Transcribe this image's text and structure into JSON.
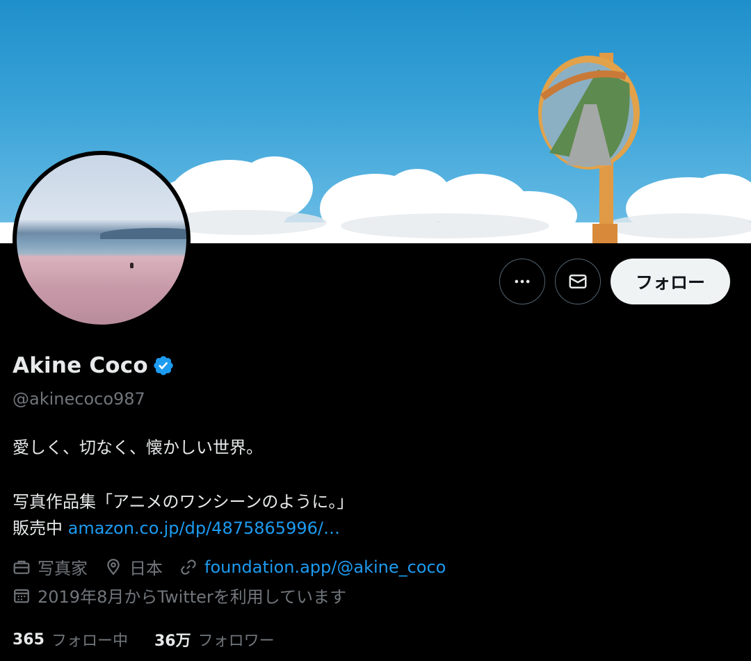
{
  "profile": {
    "name": "Akine Coco",
    "handle": "@akinecoco987",
    "bio_line1": "愛しく、切なく、懐かしい世界。",
    "bio_line2": "写真作品集「アニメのワンシーンのように。」",
    "bio_line3_prefix": "販売中 ",
    "bio_link": "amazon.co.jp/dp/4875865996/…",
    "profession": "写真家",
    "location": "日本",
    "website": "foundation.app/@akine_coco",
    "joined": "2019年8月からTwitterを利用しています"
  },
  "actions": {
    "follow_label": "フォロー",
    "more_icon": "more-dots-icon",
    "mail_icon": "mail-icon"
  },
  "stats": {
    "following_count": "365",
    "following_label": "フォロー中",
    "followers_count": "36万",
    "followers_label": "フォロワー"
  },
  "colors": {
    "accent": "#1d9bf0",
    "background": "#000000",
    "muted": "#71767b",
    "text": "#e7e9ea"
  }
}
